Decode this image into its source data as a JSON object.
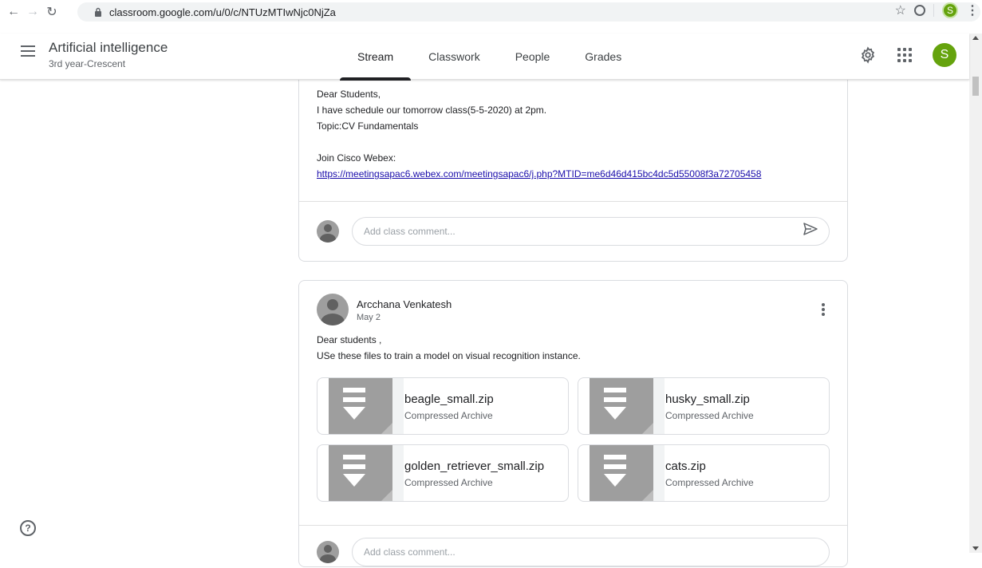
{
  "browser": {
    "url": "classroom.google.com/u/0/c/NTUzMTIwNjc0NjZa",
    "profile_initial": "S"
  },
  "header": {
    "class_title": "Artificial intelligence",
    "class_subtitle": "3rd year-Crescent",
    "tabs": [
      {
        "label": "Stream",
        "active": true
      },
      {
        "label": "Classwork",
        "active": false
      },
      {
        "label": "People",
        "active": false
      },
      {
        "label": "Grades",
        "active": false
      }
    ],
    "avatar_initial": "S"
  },
  "post1": {
    "lines": [
      "Dear Students,",
      "I have schedule our tomorrow class(5-5-2020) at 2pm.",
      "Topic:CV Fundamentals",
      "",
      "Join Cisco Webex:"
    ],
    "link": "https://meetingsapac6.webex.com/meetingsapac6/j.php?MTID=me6d46d415bc4dc5d55008f3a72705458",
    "comment_placeholder": "Add class comment..."
  },
  "post2": {
    "author": "Arcchana Venkatesh",
    "date": "May 2",
    "lines": [
      "Dear students ,",
      "USe these files to train a model on visual recognition instance."
    ],
    "attachments": [
      {
        "name": "beagle_small.zip",
        "type": "Compressed Archive"
      },
      {
        "name": "husky_small.zip",
        "type": "Compressed Archive"
      },
      {
        "name": "golden_retriever_small.zip",
        "type": "Compressed Archive"
      },
      {
        "name": "cats.zip",
        "type": "Compressed Archive"
      }
    ],
    "comment_placeholder": "Add class comment..."
  },
  "colors": {
    "accent_green": "#65a30d",
    "link_blue": "#1a0dab"
  }
}
